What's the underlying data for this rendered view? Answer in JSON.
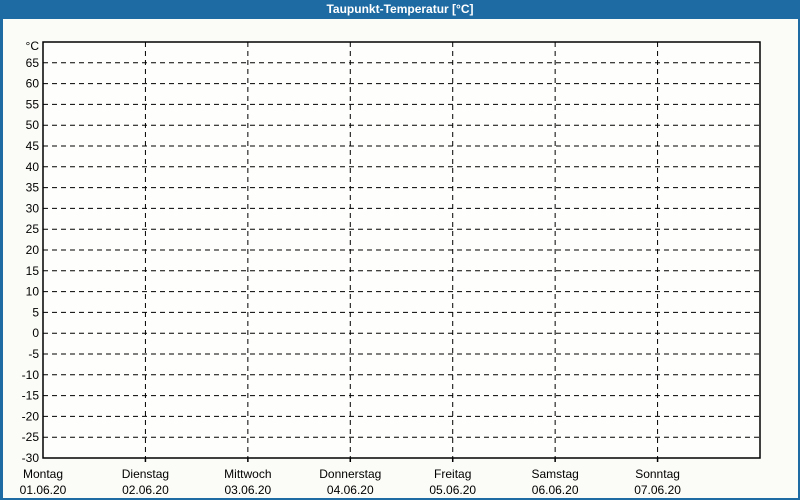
{
  "window": {
    "title": "Taupunkt-Temperatur [°C]"
  },
  "colors": {
    "title_bar": "#1e6ba3",
    "window_border": "#1e6ba3",
    "background": "#fbfcf7",
    "plot_background": "#fefefc",
    "grid_line": "#000000",
    "text": "#000000",
    "title_text": "#ffffff"
  },
  "chart_data": {
    "type": "line",
    "title": "Taupunkt-Temperatur [°C]",
    "y_axis": {
      "unit_label": "°C",
      "min": -30,
      "max": 70,
      "tick_step": 5,
      "tick_labels": [
        65,
        60,
        55,
        50,
        45,
        40,
        35,
        30,
        25,
        20,
        15,
        10,
        5,
        0,
        -5,
        -10,
        -15,
        -20,
        -25,
        -30
      ],
      "grid": "dashed"
    },
    "x_axis": {
      "categories": [
        {
          "day": "Montag",
          "date": "01.06.20"
        },
        {
          "day": "Dienstag",
          "date": "02.06.20"
        },
        {
          "day": "Mittwoch",
          "date": "03.06.20"
        },
        {
          "day": "Donnerstag",
          "date": "04.06.20"
        },
        {
          "day": "Freitag",
          "date": "05.06.20"
        },
        {
          "day": "Samstag",
          "date": "06.06.20"
        },
        {
          "day": "Sonntag",
          "date": "07.06.20"
        }
      ],
      "grid": "dashed"
    },
    "series": [],
    "legend": null
  }
}
